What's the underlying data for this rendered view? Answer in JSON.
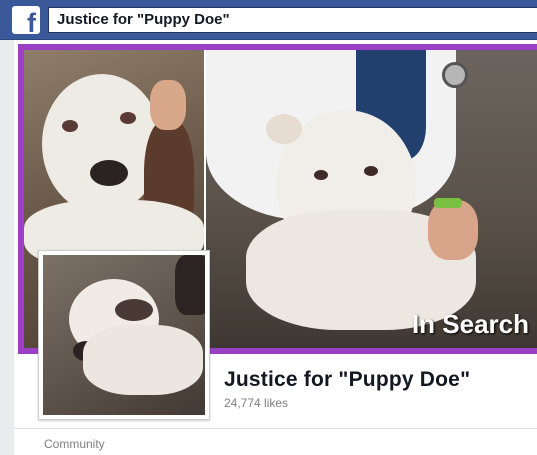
{
  "topbar": {
    "logo_glyph": "f",
    "search_value": "Justice for \"Puppy Doe\""
  },
  "cover": {
    "overlay_text": "In Search",
    "border_color": "#9b3fc5"
  },
  "page": {
    "name": "Justice for \"Puppy Doe\"",
    "likes": "24,774 likes",
    "category": "Community"
  },
  "colors": {
    "brand_blue": "#3b5998",
    "background": "#e9ebee"
  }
}
